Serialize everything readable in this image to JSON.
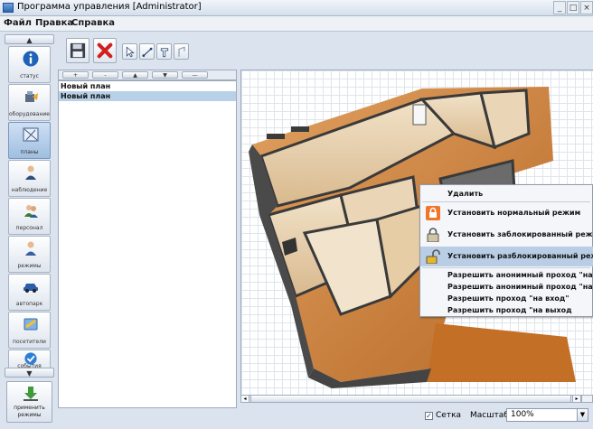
{
  "window": {
    "title": "Программа управления [Administrator]",
    "controls": [
      "_",
      "□",
      "×"
    ]
  },
  "menu": [
    "Файл",
    "Правка",
    "Справка"
  ],
  "sidebar": {
    "scroll_up": "▲",
    "scroll_down": "▼",
    "items": [
      {
        "label": "статус",
        "icon": "info-icon"
      },
      {
        "label": "оборудование",
        "icon": "equipment-icon"
      },
      {
        "label": "планы",
        "icon": "plans-icon",
        "active": true
      },
      {
        "label": "наблюдение",
        "icon": "observation-icon"
      },
      {
        "label": "персонал",
        "icon": "staff-icon"
      },
      {
        "label": "режимы",
        "icon": "modes-icon"
      },
      {
        "label": "автопарк",
        "icon": "car-icon"
      },
      {
        "label": "посетители",
        "icon": "visitors-icon"
      },
      {
        "label": "события",
        "icon": "events-icon"
      }
    ],
    "apply": {
      "line1": "применить",
      "line2": "режимы"
    }
  },
  "toolbar": {
    "tools": [
      "save-icon",
      "delete-icon",
      "select-tool-icon",
      "line-tool-icon",
      "door-tool-icon",
      "shape-tool-icon"
    ]
  },
  "plan_list": {
    "buttons": [
      "+",
      "-",
      "▲",
      "▼",
      "—"
    ],
    "items": [
      {
        "name": "Новый план",
        "selected": false
      },
      {
        "name": "Новый план",
        "selected": true
      }
    ]
  },
  "context_menu": {
    "items": [
      {
        "label": "Удалить",
        "icon": ""
      },
      {
        "label": "Установить нормальный режим",
        "icon": "normal-lock-icon"
      },
      {
        "label": "Установить заблокированный режим",
        "icon": "locked-icon"
      },
      {
        "label": "Установить разблокированный режим",
        "icon": "unlocked-icon",
        "highlighted": true
      },
      {
        "label": "Разрешить анонимный проход \"на вход\"",
        "icon": ""
      },
      {
        "label": "Разрешить анонимный проход \"на выход\"",
        "icon": ""
      },
      {
        "label": "Разрешить проход \"на вход\"",
        "icon": ""
      },
      {
        "label": "Разрешить проход \"на выход",
        "icon": ""
      }
    ]
  },
  "status": {
    "grid_label": "Сетка",
    "grid_checked": true,
    "scale_label": "Масштаб:",
    "scale_value": "100%"
  },
  "colors": {
    "accent": "#b9cde5",
    "floor": "#d28a3c",
    "wall": "#4a4a4a"
  }
}
